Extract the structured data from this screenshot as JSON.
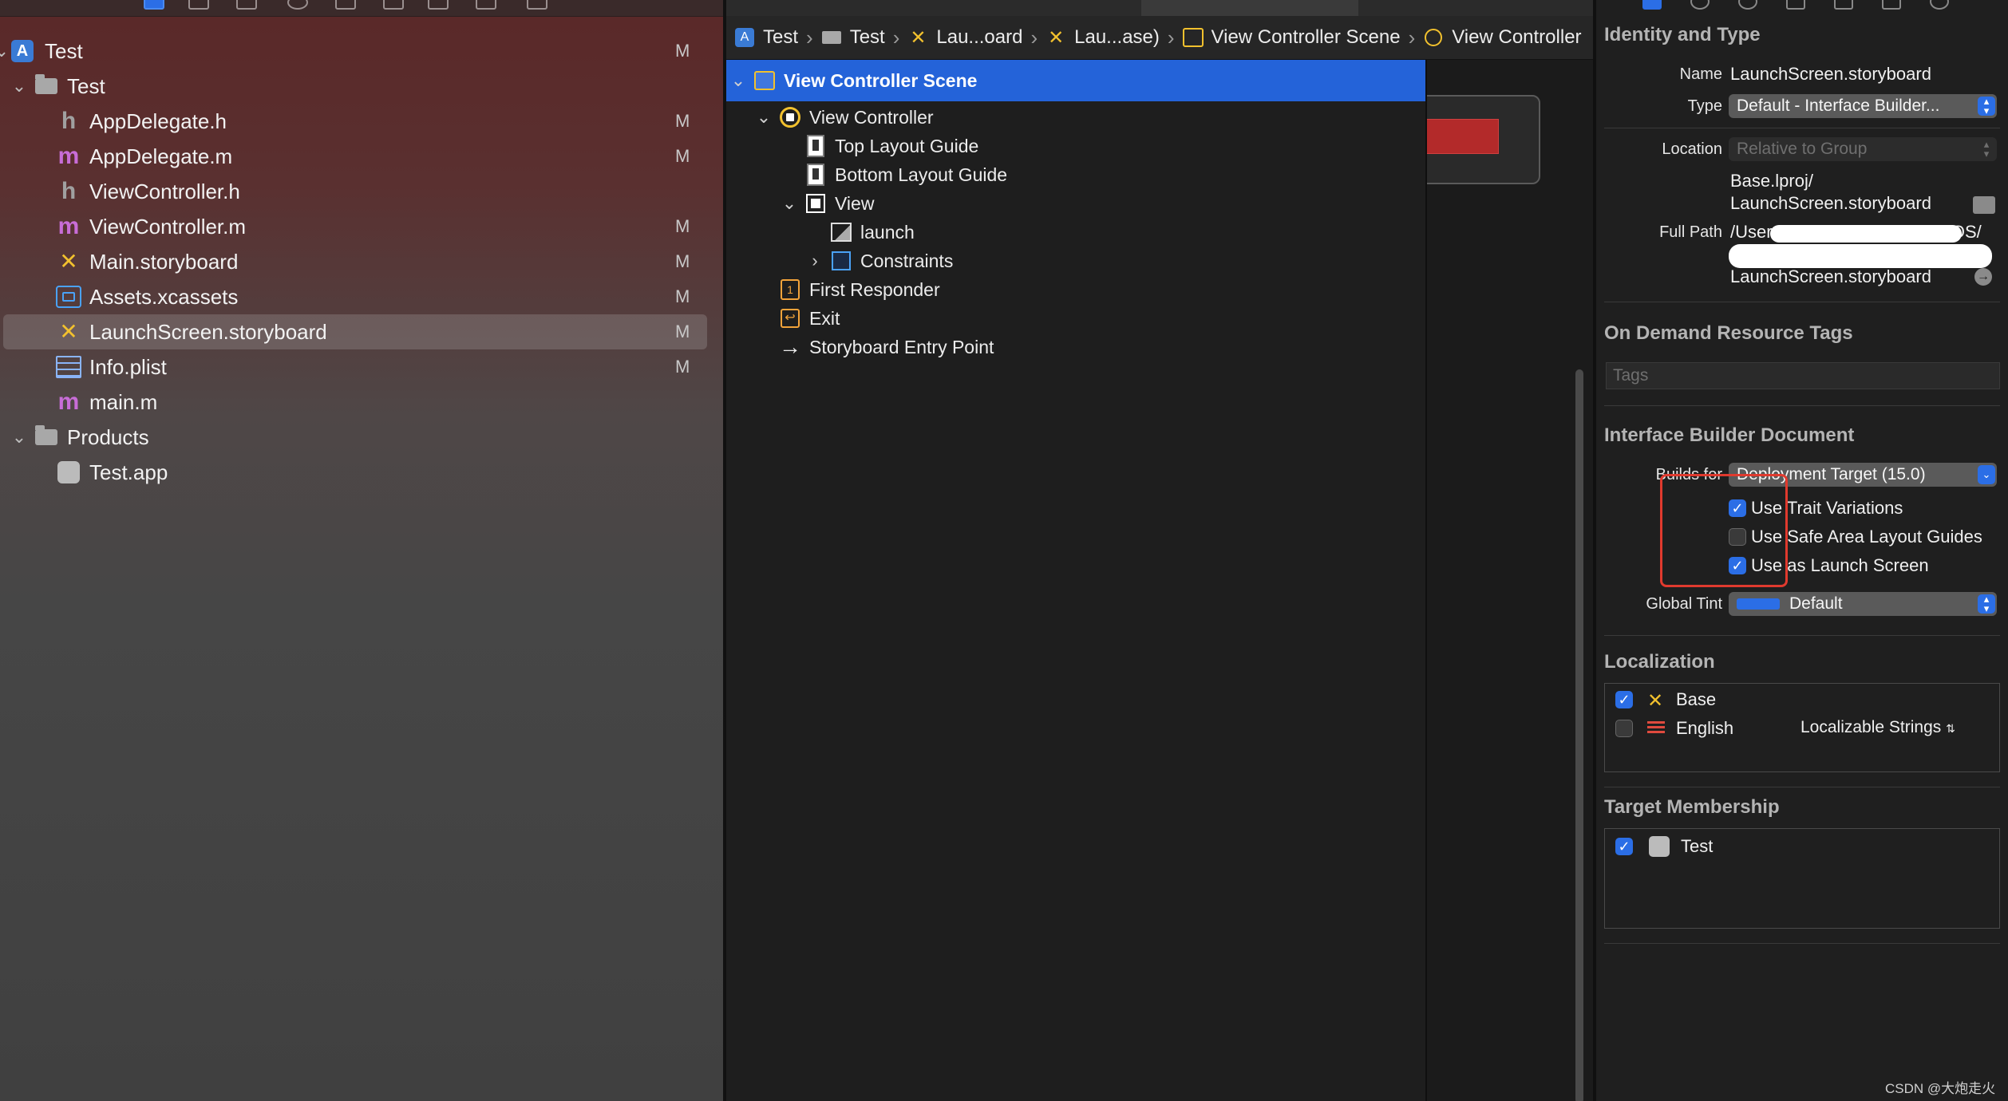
{
  "navigator": {
    "items": [
      {
        "label": "Test",
        "badge": "M",
        "icon": "project-icon"
      },
      {
        "label": "Test",
        "badge": "",
        "icon": "folder-icon"
      },
      {
        "label": "AppDelegate.h",
        "badge": "M",
        "icon": "h-file-icon"
      },
      {
        "label": "AppDelegate.m",
        "badge": "M",
        "icon": "m-file-icon"
      },
      {
        "label": "ViewController.h",
        "badge": "",
        "icon": "h-file-icon"
      },
      {
        "label": "ViewController.m",
        "badge": "M",
        "icon": "m-file-icon"
      },
      {
        "label": "Main.storyboard",
        "badge": "M",
        "icon": "storyboard-icon"
      },
      {
        "label": "Assets.xcassets",
        "badge": "M",
        "icon": "assets-icon"
      },
      {
        "label": "LaunchScreen.storyboard",
        "badge": "M",
        "icon": "storyboard-icon",
        "selected": true
      },
      {
        "label": "Info.plist",
        "badge": "M",
        "icon": "plist-icon"
      },
      {
        "label": "main.m",
        "badge": "",
        "icon": "m-file-icon"
      },
      {
        "label": "Products",
        "badge": "",
        "icon": "folder-icon"
      },
      {
        "label": "Test.app",
        "badge": "",
        "icon": "app-icon"
      }
    ],
    "glyphs": {
      "h": "h",
      "m": "m",
      "storyboard": "✕",
      "chevron_down": "⌄",
      "chevron_right": "›"
    }
  },
  "jump_bar": {
    "crumbs": [
      "Test",
      "Test",
      "Lau...oard",
      "Lau...ase)",
      "View Controller Scene",
      "View Controller"
    ]
  },
  "outline": {
    "items": [
      {
        "label": "View Controller Scene",
        "selected": true
      },
      {
        "label": "View Controller"
      },
      {
        "label": "Top Layout Guide"
      },
      {
        "label": "Bottom Layout Guide"
      },
      {
        "label": "View"
      },
      {
        "label": "launch"
      },
      {
        "label": "Constraints"
      },
      {
        "label": "First Responder"
      },
      {
        "label": "Exit"
      },
      {
        "label": "Storyboard Entry Point"
      }
    ]
  },
  "inspector": {
    "identity": {
      "title": "Identity and Type",
      "name_label": "Name",
      "name_value": "LaunchScreen.storyboard",
      "type_label": "Type",
      "type_value": "Default - Interface Builder...",
      "location_label": "Location",
      "location_value": "Relative to Group",
      "location_path_1": "Base.lproj/",
      "location_path_2": "LaunchScreen.storyboard",
      "full_path_label": "Full Path",
      "full_path_1": "/Users/",
      "full_path_1_end": "iOS/",
      "full_path_3": "LaunchScreen.storyboard"
    },
    "tags": {
      "title": "On Demand Resource Tags",
      "placeholder": "Tags"
    },
    "ib_document": {
      "title": "Interface Builder Document",
      "builds_for_label": "Builds for",
      "builds_for_value": "Deployment Target (15.0)",
      "use_trait_variations": {
        "label": "Use Trait Variations",
        "checked": true
      },
      "use_safe_area": {
        "label": "Use Safe Area Layout Guides",
        "checked": false
      },
      "use_launch_screen": {
        "label": "Use as Launch Screen",
        "checked": true
      },
      "global_tint_label": "Global Tint",
      "global_tint_value": "Default",
      "tint_color": "#2b6ee6"
    },
    "localization": {
      "title": "Localization",
      "base": {
        "label": "Base",
        "checked": true
      },
      "english": {
        "label": "English",
        "checked": false,
        "mode": "Localizable Strings"
      }
    },
    "target_membership": {
      "title": "Target Membership",
      "target": {
        "label": "Test",
        "checked": true
      }
    }
  },
  "watermark": "CSDN @大炮走火",
  "colors": {
    "selection_blue": "#2463d9",
    "checkbox_blue": "#2b6ee6",
    "annotation_red": "#e03a2e",
    "storyboard_yellow": "#f2c12e",
    "m_file_purple": "#c86dd7"
  }
}
